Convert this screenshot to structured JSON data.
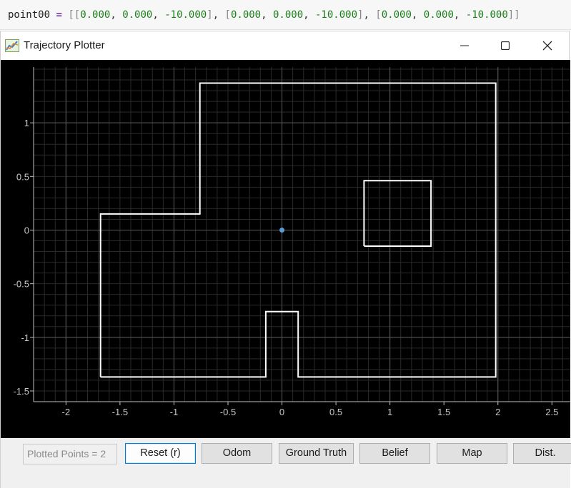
{
  "code": {
    "var_name": "point00",
    "op": "=",
    "tokens": [
      {
        "t": "br",
        "v": "[["
      },
      {
        "t": "num",
        "v": "0.000"
      },
      {
        "t": "plain",
        "v": ", "
      },
      {
        "t": "num",
        "v": "0.000"
      },
      {
        "t": "plain",
        "v": ", "
      },
      {
        "t": "num",
        "v": "-10.000"
      },
      {
        "t": "br",
        "v": "]"
      },
      {
        "t": "plain",
        "v": ", "
      },
      {
        "t": "br",
        "v": "["
      },
      {
        "t": "num",
        "v": "0.000"
      },
      {
        "t": "plain",
        "v": ", "
      },
      {
        "t": "num",
        "v": "0.000"
      },
      {
        "t": "plain",
        "v": ", "
      },
      {
        "t": "num",
        "v": "-10.000"
      },
      {
        "t": "br",
        "v": "]"
      },
      {
        "t": "plain",
        "v": ", "
      },
      {
        "t": "br",
        "v": "["
      },
      {
        "t": "num",
        "v": "0.000"
      },
      {
        "t": "plain",
        "v": ", "
      },
      {
        "t": "num",
        "v": "0.000"
      },
      {
        "t": "plain",
        "v": ", "
      },
      {
        "t": "num",
        "v": "-10.000"
      },
      {
        "t": "br",
        "v": "]]"
      }
    ]
  },
  "window": {
    "title": "Trajectory Plotter",
    "icon": "chart-line-icon"
  },
  "chart_data": {
    "type": "line",
    "title": "",
    "xlabel": "",
    "ylabel": "",
    "xlim": [
      -2.3,
      2.67
    ],
    "ylim": [
      -1.6,
      1.52
    ],
    "grid": true,
    "x_ticks": [
      -2,
      -1.5,
      -1,
      -0.5,
      0,
      0.5,
      1,
      1.5,
      2,
      2.5
    ],
    "x_tick_labels": [
      "-2",
      "-1.5",
      "-1",
      "-0.5",
      "0",
      "0.5",
      "1",
      "1.5",
      "2",
      "2.5"
    ],
    "y_ticks": [
      -1.5,
      -1,
      -0.5,
      0,
      0.5,
      1
    ],
    "y_tick_labels": [
      "-1.5",
      "-1",
      "-0.5",
      "0",
      "0.5",
      "1"
    ],
    "series": [
      {
        "kind": "map",
        "points": [
          [
            -1.68,
            -1.37
          ],
          [
            -0.15,
            -1.37
          ],
          [
            -0.15,
            -0.76
          ],
          [
            0.15,
            -0.76
          ],
          [
            0.15,
            -1.37
          ],
          [
            1.98,
            -1.37
          ],
          [
            1.98,
            1.37
          ],
          [
            -0.76,
            1.37
          ],
          [
            -0.76,
            0.15
          ],
          [
            -1.68,
            0.15
          ],
          [
            -1.68,
            -1.37
          ]
        ]
      },
      {
        "kind": "map",
        "points": [
          [
            0.76,
            -0.15
          ],
          [
            1.38,
            -0.15
          ],
          [
            1.38,
            0.46
          ],
          [
            0.76,
            0.46
          ],
          [
            0.76,
            -0.15
          ]
        ]
      },
      {
        "kind": "point",
        "points": [
          [
            0,
            0
          ]
        ]
      }
    ],
    "colors": {
      "map": "#ffffff",
      "point": "#5b9bd5",
      "grid_major": "#5a5a5a",
      "grid_minor": "#2a2a2a",
      "axis_text": "#c8c8c8"
    }
  },
  "status": {
    "text": "Plotted Points = 2"
  },
  "buttons": [
    {
      "label": "Reset (r)",
      "name": "reset-button",
      "primary": true
    },
    {
      "label": "Odom",
      "name": "odom-button"
    },
    {
      "label": "Ground Truth",
      "name": "ground-truth-button"
    },
    {
      "label": "Belief",
      "name": "belief-button"
    },
    {
      "label": "Map",
      "name": "map-button"
    },
    {
      "label": "Dist.",
      "name": "dist-button"
    }
  ]
}
